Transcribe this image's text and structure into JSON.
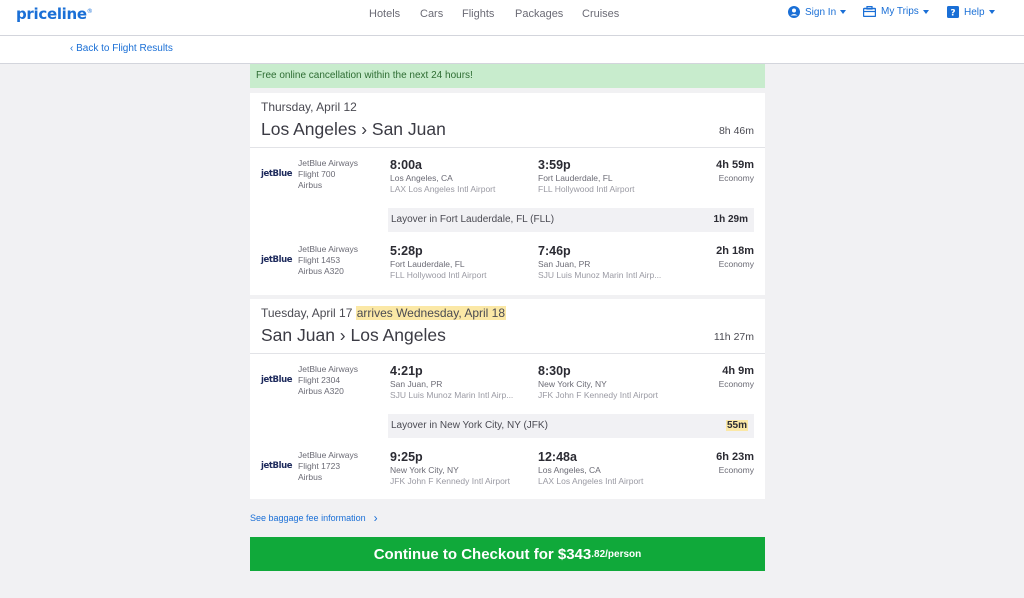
{
  "brand": {
    "logo": "priceline"
  },
  "nav": [
    "Hotels",
    "Cars",
    "Flights",
    "Packages",
    "Cruises"
  ],
  "utility": {
    "sign_in": "Sign In",
    "my_trips": "My Trips",
    "help": "Help"
  },
  "back_link": "Back to Flight Results",
  "banner": "Free online cancellation within the next 24 hours!",
  "legs": [
    {
      "date": "Thursday, April 12",
      "route": "Los Angeles › San Juan",
      "total": "8h 46m",
      "segments": [
        {
          "logo": "jetBlue",
          "airline": "JetBlue Airways",
          "flight": "Flight 700",
          "aircraft": "Airbus",
          "dep_time": "8:00a",
          "dep_city": "Los Angeles, CA",
          "dep_airport": "LAX Los Angeles Intl Airport",
          "arr_time": "3:59p",
          "arr_city": "Fort Lauderdale, FL",
          "arr_airport": "FLL Hollywood Intl Airport",
          "duration": "4h 59m",
          "cabin": "Economy"
        },
        {
          "logo": "jetBlue",
          "airline": "JetBlue Airways",
          "flight": "Flight 1453",
          "aircraft": "Airbus A320",
          "dep_time": "5:28p",
          "dep_city": "Fort Lauderdale, FL",
          "dep_airport": "FLL Hollywood Intl Airport",
          "arr_time": "7:46p",
          "arr_city": "San Juan, PR",
          "arr_airport": "SJU Luis Munoz Marin Intl Airp...",
          "duration": "2h 18m",
          "cabin": "Economy"
        }
      ],
      "layover": {
        "text": "Layover in Fort Lauderdale, FL (FLL)",
        "duration": "1h 29m"
      }
    },
    {
      "date": "Tuesday, April 17",
      "arrives_note": "arrives Wednesday, April 18",
      "route": "San Juan › Los Angeles",
      "total": "11h 27m",
      "segments": [
        {
          "logo": "jetBlue",
          "airline": "JetBlue Airways",
          "flight": "Flight 2304",
          "aircraft": "Airbus A320",
          "dep_time": "4:21p",
          "dep_city": "San Juan, PR",
          "dep_airport": "SJU Luis Munoz Marin Intl Airp...",
          "arr_time": "8:30p",
          "arr_city": "New York City, NY",
          "arr_airport": "JFK John F Kennedy Intl Airport",
          "duration": "4h 9m",
          "cabin": "Economy"
        },
        {
          "logo": "jetBlue",
          "airline": "JetBlue Airways",
          "flight": "Flight 1723",
          "aircraft": "Airbus",
          "dep_time": "9:25p",
          "dep_city": "New York City, NY",
          "dep_airport": "JFK John F Kennedy Intl Airport",
          "arr_time": "12:48a",
          "arr_city": "Los Angeles, CA",
          "arr_airport": "LAX Los Angeles Intl Airport",
          "duration": "6h 23m",
          "cabin": "Economy"
        }
      ],
      "layover": {
        "text": "Layover in New York City, NY (JFK)",
        "duration": "55m"
      }
    }
  ],
  "baggage_link": "See baggage fee information",
  "checkout": {
    "label": "Continue to Checkout for $343",
    "cents": ".82/person"
  },
  "colors": {
    "brand_blue": "#1a6fd6",
    "cta_green": "#10a93a",
    "banner_green": "#c8eccd",
    "highlight": "#fbe8a6"
  }
}
